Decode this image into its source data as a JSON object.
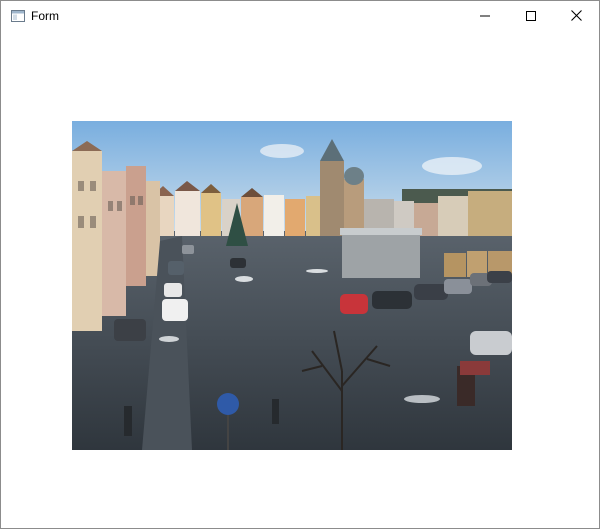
{
  "window": {
    "title": "Form",
    "controls": {
      "minimize": "minimize-icon",
      "maximize": "maximize-icon",
      "close": "close-icon"
    }
  },
  "content": {
    "image": "webcam-photo-town-square"
  },
  "colors": {
    "sky_top": "#7fb2e0",
    "sky_bottom": "#c9dcea",
    "ground": "#3f4750",
    "title_text": "#000000"
  }
}
